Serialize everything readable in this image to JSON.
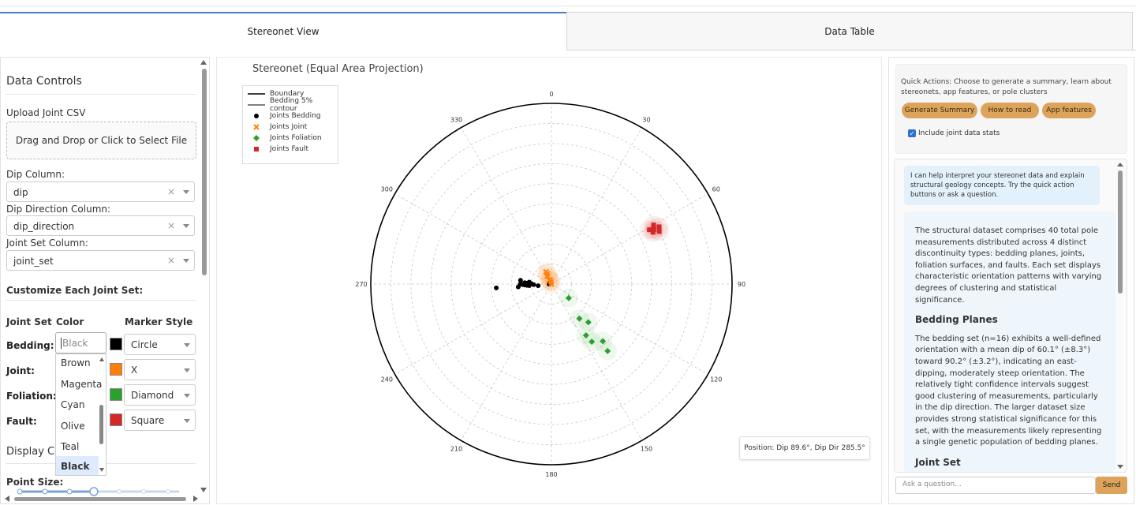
{
  "tabs": [
    {
      "label": "Stereonet View"
    },
    {
      "label": "Data Table"
    }
  ],
  "left": {
    "title": "Data Controls",
    "upload_label": "Upload Joint CSV",
    "dropzone_text": "Drag and Drop or Click to Select File",
    "dip_label": "Dip Column:",
    "dip_value": "dip",
    "dipdir_label": "Dip Direction Column:",
    "dipdir_value": "dip_direction",
    "jointset_label": "Joint Set Column:",
    "jointset_value": "joint_set",
    "clear_glyph": "×",
    "customize_title": "Customize Each Joint Set:",
    "headers": {
      "set": "Joint Set",
      "color": "Color",
      "marker": "Marker Style"
    },
    "sets": [
      {
        "name": "Bedding:",
        "color": "#000000",
        "marker": "Circle"
      },
      {
        "name": "Joint:",
        "color": "#ff7f0e",
        "marker": "X"
      },
      {
        "name": "Foliation:",
        "color": "#2ca02c",
        "marker": "Diamond"
      },
      {
        "name": "Fault:",
        "color": "#d62728",
        "marker": "Square"
      }
    ],
    "color_input_value": "Black",
    "color_options": [
      "Brown",
      "Magenta",
      "Cyan",
      "Olive",
      "Teal",
      "Black"
    ],
    "display_title": "Display Co",
    "point_size_label": "Point Size:"
  },
  "center": {
    "title": "Stereonet (Equal Area Projection)",
    "legend": [
      {
        "label": "Boundary",
        "kind": "line"
      },
      {
        "label": "Bedding 5% contour",
        "kind": "thinline"
      },
      {
        "label": "Joints Bedding",
        "kind": "circle",
        "color": "#000000"
      },
      {
        "label": "Joints Joint",
        "kind": "x",
        "color": "#ff7f0e"
      },
      {
        "label": "Joints Foliation",
        "kind": "diamond",
        "color": "#2ca02c"
      },
      {
        "label": "Joints Fault",
        "kind": "square",
        "color": "#d62728"
      }
    ],
    "azimuth_labels": [
      "0",
      "30",
      "60",
      "90",
      "120",
      "150",
      "180",
      "210",
      "240",
      "270",
      "300",
      "330"
    ],
    "position_text": "Position: Dip 89.6°, Dip Dir 285.5°"
  },
  "right": {
    "quick_actions_text": "Quick Actions: Choose to generate a summary, learn about stereonets, app features, or pole clusters",
    "buttons": [
      "Generate Summary",
      "How to read",
      "App features"
    ],
    "include_stats_label": "Include joint data stats",
    "bot_intro": "I can help interpret your stereonet data and explain structural geology concepts. Try the quick action buttons or ask a question.",
    "summary_p1": "The structural dataset comprises 40 total pole measurements distributed across 4 distinct discontinuity types: bedding planes, joints, foliation surfaces, and faults. Each set displays characteristic orientation patterns with varying degrees of clustering and statistical significance.",
    "heading_bedding": "Bedding Planes",
    "summary_p2": "The bedding set (n=16) exhibits a well-defined orientation with a mean dip of 60.1° (±8.3°) toward 90.2° (±3.2°), indicating an east-dipping, moderately steep orientation. The relatively tight confidence intervals suggest good clustering of measurements, particularly in the dip direction. The larger dataset size provides strong statistical significance for this set, with the measurements likely representing a single genetic population of bedding planes.",
    "heading_joint": "Joint Set",
    "ask_placeholder": "Ask a question...",
    "send_label": "Send"
  },
  "stereonet_data": {
    "bedding_poles_dipdir": [
      [
        78,
        268
      ],
      [
        80,
        270
      ],
      [
        79,
        272
      ],
      [
        81,
        271
      ],
      [
        77,
        269
      ],
      [
        80,
        266
      ],
      [
        82,
        268
      ],
      [
        78,
        273
      ],
      [
        76,
        270
      ],
      [
        79,
        267
      ],
      [
        80,
        275
      ],
      [
        75,
        265
      ],
      [
        84,
        263
      ],
      [
        89,
        264
      ],
      [
        65,
        266
      ],
      [
        76,
        277
      ]
    ],
    "joint_poles": [
      [
        88,
        330
      ],
      [
        86,
        333
      ],
      [
        84,
        336
      ],
      [
        88,
        345
      ],
      [
        89,
        348
      ],
      [
        90,
        326
      ],
      [
        85,
        339
      ]
    ],
    "foliation_poles": [
      [
        50,
        140
      ],
      [
        58,
        145
      ],
      [
        55,
        138
      ],
      [
        70,
        141
      ],
      [
        66,
        136
      ],
      [
        62,
        146
      ],
      [
        80,
        129
      ]
    ],
    "fault_poles": [
      [
        36,
        62
      ],
      [
        33,
        62
      ],
      [
        35,
        60
      ],
      [
        37,
        63
      ],
      [
        34,
        64
      ],
      [
        38,
        61
      ]
    ]
  }
}
